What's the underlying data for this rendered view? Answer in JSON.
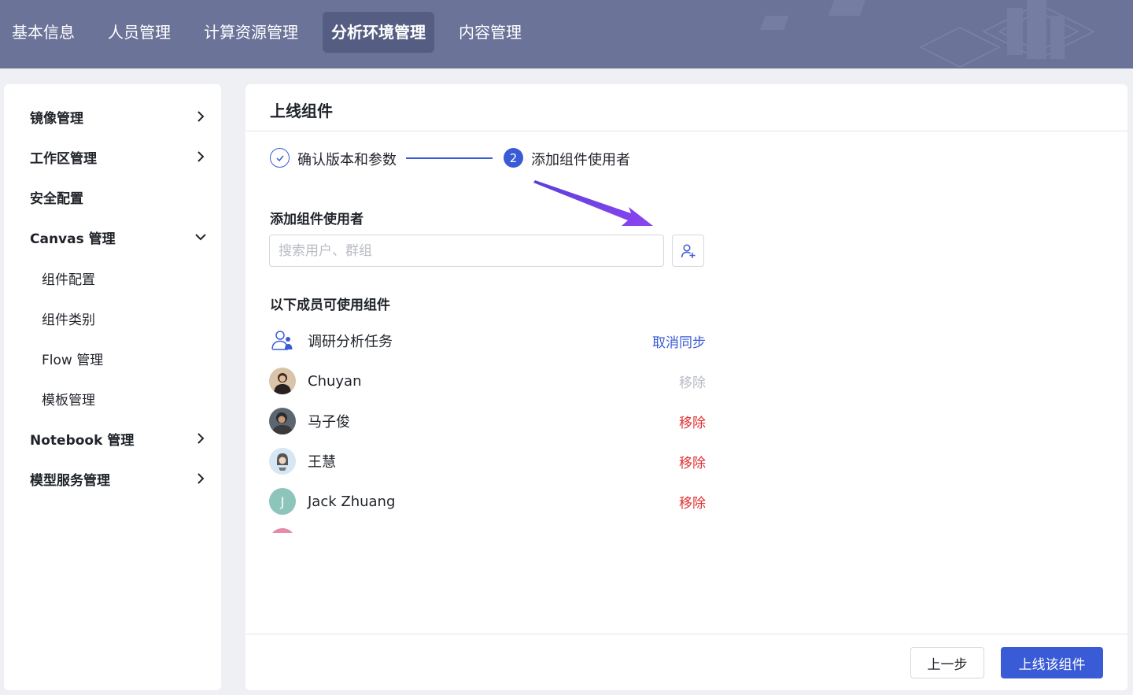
{
  "colors": {
    "topbar": "#6b7399",
    "accent": "#3a5bd6",
    "danger": "#e03131",
    "disabled": "#b8bcc4"
  },
  "topnav": {
    "items": [
      {
        "label": "基本信息"
      },
      {
        "label": "人员管理"
      },
      {
        "label": "计算资源管理"
      },
      {
        "label": "分析环境管理",
        "active": true
      },
      {
        "label": "内容管理"
      }
    ]
  },
  "sidebar": {
    "items": [
      {
        "label": "镜像管理",
        "icon": "chevron-right-icon"
      },
      {
        "label": "工作区管理",
        "icon": "chevron-right-icon"
      },
      {
        "label": "安全配置"
      },
      {
        "label": "Canvas 管理",
        "icon": "chevron-down-icon",
        "expanded": true
      },
      {
        "label": "Notebook 管理",
        "icon": "chevron-right-icon"
      },
      {
        "label": "模型服务管理",
        "icon": "chevron-right-icon"
      }
    ],
    "canvas_children": [
      {
        "label": "组件配置"
      },
      {
        "label": "组件类别"
      },
      {
        "label": "Flow 管理"
      },
      {
        "label": "模板管理"
      }
    ]
  },
  "main": {
    "title": "上线组件",
    "steps": [
      {
        "label": "确认版本和参数",
        "status": "done",
        "icon": "check-icon"
      },
      {
        "label": "添加组件使用者",
        "status": "current",
        "number": "2"
      }
    ],
    "add_section_title": "添加组件使用者",
    "search": {
      "placeholder": "搜索用户、群组",
      "value": ""
    },
    "add_user_icon": "add-user-icon",
    "members_title": "以下成员可使用组件",
    "members": [
      {
        "name": "调研分析任务",
        "type": "group",
        "action": "取消同步",
        "action_style": "link"
      },
      {
        "name": "Chuyan",
        "type": "user",
        "action": "移除",
        "action_style": "disabled"
      },
      {
        "name": "马子俊",
        "type": "user",
        "action": "移除",
        "action_style": "danger"
      },
      {
        "name": "王慧",
        "type": "user",
        "action": "移除",
        "action_style": "danger"
      },
      {
        "name": "Jack Zhuang",
        "type": "user",
        "initial": "J",
        "action": "移除",
        "action_style": "danger"
      }
    ],
    "footer": {
      "prev_label": "上一步",
      "submit_label": "上线该组件"
    }
  }
}
